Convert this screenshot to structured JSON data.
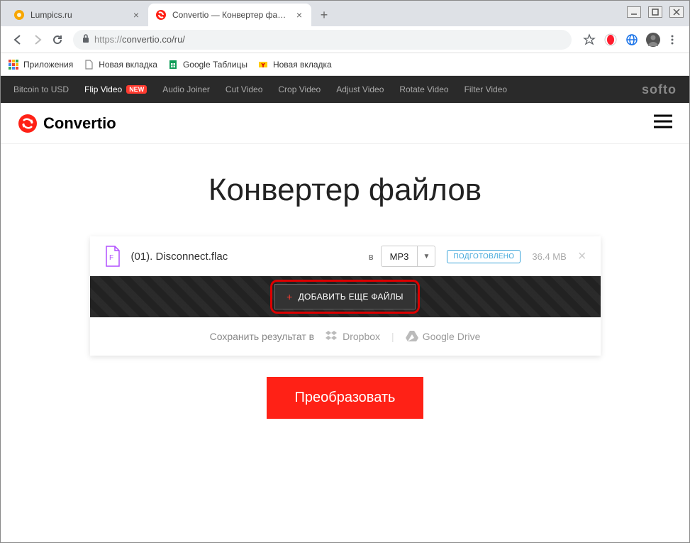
{
  "window": {
    "minimize_icon": "minimize",
    "maximize_icon": "maximize",
    "close_icon": "close"
  },
  "tabs": [
    {
      "title": "Lumpics.ru",
      "favicon_color": "#f7a600"
    },
    {
      "title": "Convertio — Конвертер файлов",
      "favicon": "convertio",
      "active": true
    }
  ],
  "address_bar": {
    "url_prefix": "https://",
    "url": "convertio.co/ru/"
  },
  "bookmarks": [
    {
      "icon": "apps",
      "label": "Приложения"
    },
    {
      "icon": "page",
      "label": "Новая вкладка"
    },
    {
      "icon": "sheets",
      "label": "Google Таблицы"
    },
    {
      "icon": "yandex",
      "label": "Новая вкладка"
    }
  ],
  "promo": {
    "links": [
      {
        "label": "Bitcoin to USD"
      },
      {
        "label": "Flip Video",
        "white": true,
        "new": true
      },
      {
        "label": "Audio Joiner"
      },
      {
        "label": "Cut Video"
      },
      {
        "label": "Crop Video"
      },
      {
        "label": "Adjust Video"
      },
      {
        "label": "Rotate Video"
      },
      {
        "label": "Filter Video"
      }
    ],
    "new_badge": "NEW",
    "brand": "softo"
  },
  "site": {
    "brand": "Convertio"
  },
  "page": {
    "title": "Конвертер файлов"
  },
  "file_card": {
    "file_name": "(01). Disconnect.flac",
    "to_label": "в",
    "format": "MP3",
    "status": "ПОДГОТОВЛЕНО",
    "size": "36.4 MB",
    "add_more_label": "ДОБАВИТЬ ЕЩЕ ФАЙЛЫ",
    "save_label": "Сохранить результат в",
    "dropbox": "Dropbox",
    "gdrive": "Google Drive"
  },
  "convert_button": "Преобразовать"
}
